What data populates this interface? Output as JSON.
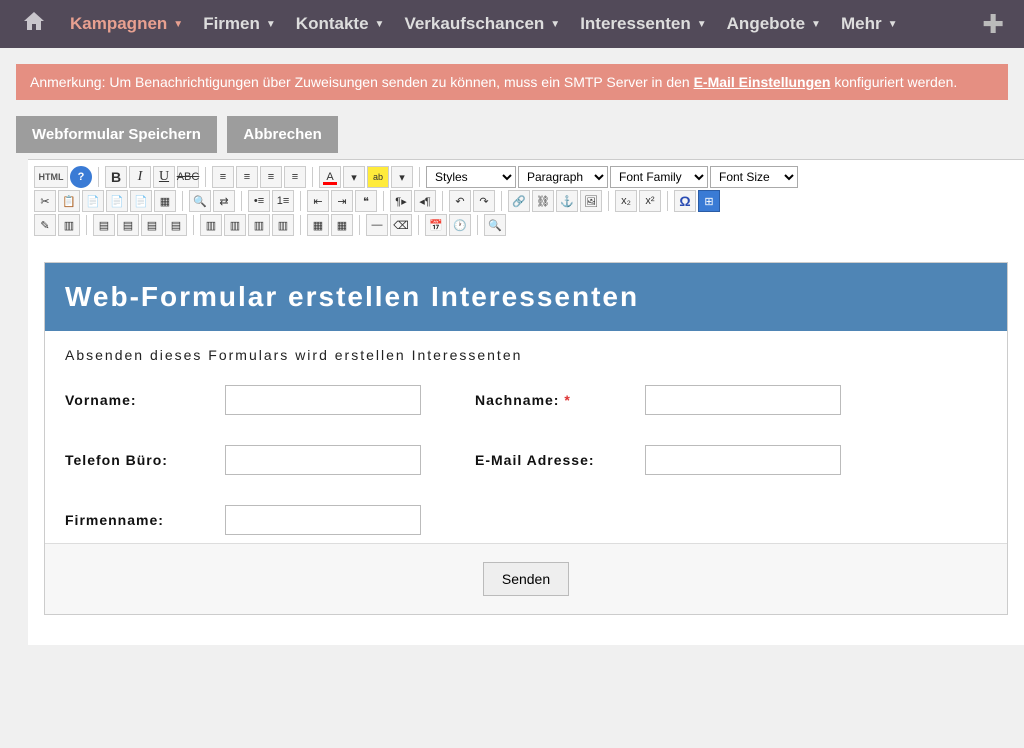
{
  "nav": {
    "home_icon": "home-icon",
    "items": [
      {
        "label": "Kampagnen",
        "active": true
      },
      {
        "label": "Firmen"
      },
      {
        "label": "Kontakte"
      },
      {
        "label": "Verkaufschancen"
      },
      {
        "label": "Interessenten"
      },
      {
        "label": "Angebote"
      },
      {
        "label": "Mehr"
      }
    ],
    "plus_icon": "plus-icon"
  },
  "notice": {
    "prefix": "Anmerkung: ",
    "text_before": "Um Benachrichtigungen über Zuweisungen senden zu können, muss ein SMTP Server in den ",
    "link_text": "E-Mail Einstellungen",
    "text_after": " konfiguriert werden."
  },
  "actions": {
    "save": "Webformular Speichern",
    "cancel": "Abbrechen"
  },
  "toolbar": {
    "html": "HTML",
    "dropdowns": {
      "styles": "Styles",
      "paragraph": "Paragraph",
      "font_family": "Font Family",
      "font_size": "Font Size"
    }
  },
  "form": {
    "title": "Web-Formular erstellen Interessenten",
    "description": "Absenden dieses Formulars wird erstellen Interessenten",
    "fields": {
      "vorname": {
        "label": "Vorname:"
      },
      "nachname": {
        "label": "Nachname:",
        "required": "*"
      },
      "telefon": {
        "label": "Telefon Büro:"
      },
      "email": {
        "label": "E-Mail Adresse:"
      },
      "firmenname": {
        "label": "Firmenname:"
      }
    },
    "submit": "Senden"
  }
}
